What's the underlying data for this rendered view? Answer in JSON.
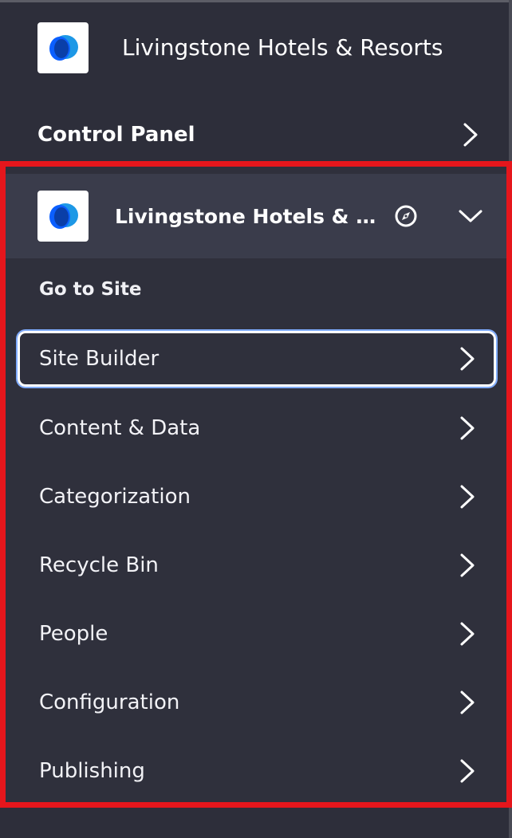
{
  "header": {
    "title": "Livingstone Hotels & Resorts",
    "logo_icon": "liferay-logo-icon"
  },
  "control_panel": {
    "label": "Control Panel",
    "icon": "chevron-right-icon"
  },
  "site": {
    "name": "Livingstone Hotels & Resorts",
    "logo_icon": "liferay-logo-icon",
    "go_to_site_icon": "compass-icon",
    "collapse_icon": "chevron-down-icon",
    "go_to_site_label": "Go to Site"
  },
  "menu": {
    "items": [
      {
        "label": "Site Builder",
        "active": true
      },
      {
        "label": "Content & Data",
        "active": false
      },
      {
        "label": "Categorization",
        "active": false
      },
      {
        "label": "Recycle Bin",
        "active": false
      },
      {
        "label": "People",
        "active": false
      },
      {
        "label": "Configuration",
        "active": false
      },
      {
        "label": "Publishing",
        "active": false
      }
    ]
  },
  "colors": {
    "background": "#2d2e3a",
    "site_header_bg": "#3a3c4b",
    "highlight_border": "#e5161c",
    "focus_ring": "#80acff",
    "logo_blue_dark": "#0b5fff",
    "logo_blue_light": "#1d98e6"
  }
}
